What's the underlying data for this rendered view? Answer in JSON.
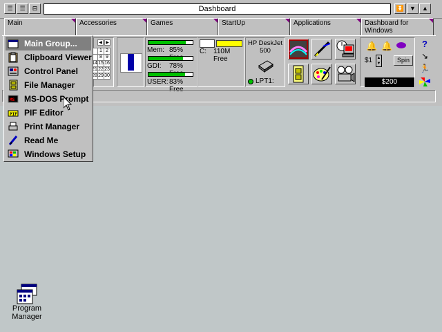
{
  "window": {
    "title": "Dashboard"
  },
  "tabs": [
    {
      "label": "Main"
    },
    {
      "label": "Accessories"
    },
    {
      "label": "Games"
    },
    {
      "label": "StartUp"
    },
    {
      "label": "Applications"
    },
    {
      "label": "Dashboard for Windows"
    }
  ],
  "menu": {
    "items": [
      {
        "label": "Main Group...",
        "icon": "group-icon",
        "selected": true
      },
      {
        "label": "Clipboard Viewer",
        "icon": "clipboard-icon"
      },
      {
        "label": "Control Panel",
        "icon": "control-panel-icon"
      },
      {
        "label": "File Manager",
        "icon": "file-manager-icon"
      },
      {
        "label": "MS-DOS Prompt",
        "icon": "msdos-icon"
      },
      {
        "label": "PIF Editor",
        "icon": "pif-editor-icon"
      },
      {
        "label": "Print Manager",
        "icon": "printer-icon"
      },
      {
        "label": "Read Me",
        "icon": "read-me-icon"
      },
      {
        "label": "Windows Setup",
        "icon": "windows-setup-icon"
      }
    ]
  },
  "calendar": {
    "rows": [
      [
        "",
        "1",
        "2"
      ],
      [
        "",
        "8",
        "9"
      ],
      [
        "14",
        "15",
        "16"
      ],
      [
        "21",
        "22",
        "23"
      ],
      [
        "28",
        "29",
        "30"
      ]
    ]
  },
  "resources": {
    "mem": {
      "label": "Mem:",
      "value": "85% Free",
      "fraction": 0.85
    },
    "gdi": {
      "label": "GDI:",
      "value": "78% Free",
      "fraction": 0.78
    },
    "user": {
      "label": "USER:",
      "value": "83% Free",
      "fraction": 0.83
    }
  },
  "disk": {
    "drive": "C:",
    "free": "110M Free"
  },
  "printer": {
    "name": "HP DeskJet 500",
    "port": "LPT1:"
  },
  "slot": {
    "bet": "$1",
    "spin_label": "Spin",
    "balance": "$200"
  },
  "desktop": {
    "program_manager_label": "Program Manager"
  }
}
